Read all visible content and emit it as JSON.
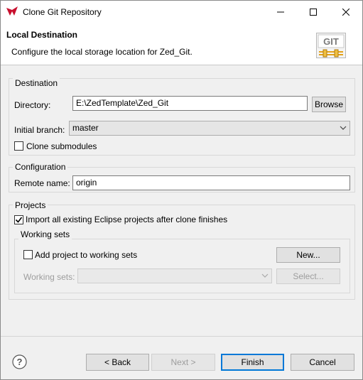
{
  "window": {
    "title": "Clone Git Repository"
  },
  "banner": {
    "title": "Local Destination",
    "description": "Configure the local storage location for Zed_Git.",
    "logo_text": "GIT"
  },
  "destination": {
    "group_label": "Destination",
    "directory_label": "Directory:",
    "directory_value": "E:\\ZedTemplate\\Zed_Git",
    "browse_label": "Browse",
    "branch_label": "Initial branch:",
    "branch_value": "master",
    "clone_submodules_label": "Clone submodules",
    "clone_submodules_checked": false
  },
  "configuration": {
    "group_label": "Configuration",
    "remote_name_label": "Remote name:",
    "remote_name_value": "origin"
  },
  "projects": {
    "group_label": "Projects",
    "import_label": "Import all existing Eclipse projects after clone finishes",
    "import_checked": true,
    "working_sets": {
      "group_label": "Working sets",
      "add_label": "Add project to working sets",
      "add_checked": false,
      "new_label": "New...",
      "sets_label": "Working sets:",
      "sets_value": "",
      "select_label": "Select..."
    }
  },
  "footer": {
    "back_label": "< Back",
    "next_label": "Next >",
    "finish_label": "Finish",
    "cancel_label": "Cancel"
  },
  "colors": {
    "accent": "#0078d7",
    "app_icon": "#c8102e",
    "disabled_text": "#9d9d9d"
  }
}
